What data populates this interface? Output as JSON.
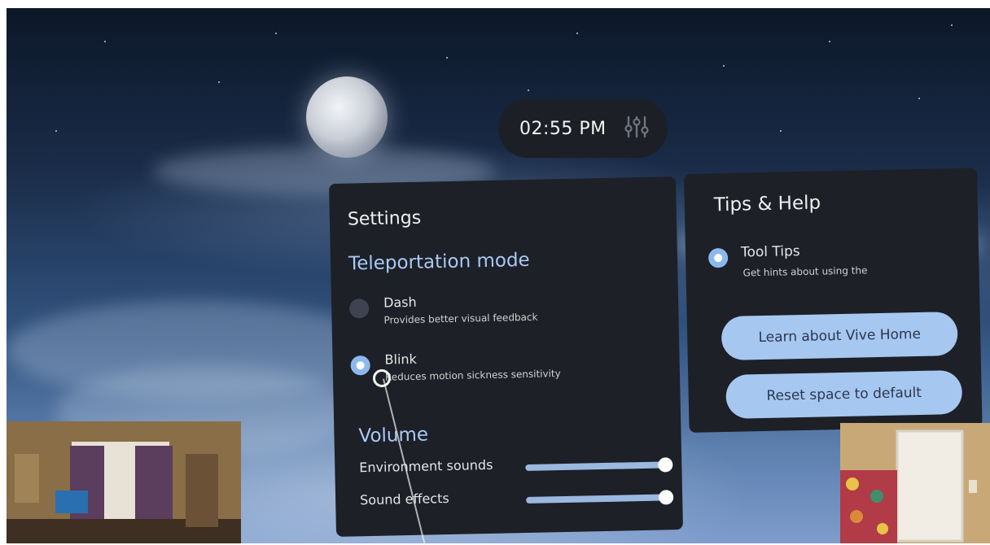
{
  "clock": {
    "time": "02:55 PM",
    "icon": "sliders-icon"
  },
  "settings": {
    "title": "Settings",
    "teleportation": {
      "heading": "Teleportation mode",
      "options": [
        {
          "label": "Dash",
          "description": "Provides better visual feedback",
          "selected": false
        },
        {
          "label": "Blink",
          "description": "Reduces motion sickness sensitivity",
          "selected": true
        }
      ]
    },
    "volume": {
      "heading": "Volume",
      "sliders": [
        {
          "label": "Environment sounds",
          "level": 1.0
        },
        {
          "label": "Sound effects",
          "level": 1.0
        }
      ]
    }
  },
  "tips": {
    "title": "Tips & Help",
    "tooltips": {
      "label": "Tool Tips",
      "description": "Get hints about using the",
      "selected": true
    },
    "buttons": {
      "learn": "Learn about Vive Home",
      "reset": "Reset space to default"
    }
  },
  "colors": {
    "panel": "#1d2027",
    "accent": "#a9c9f5",
    "button": "#a6c7f0"
  }
}
